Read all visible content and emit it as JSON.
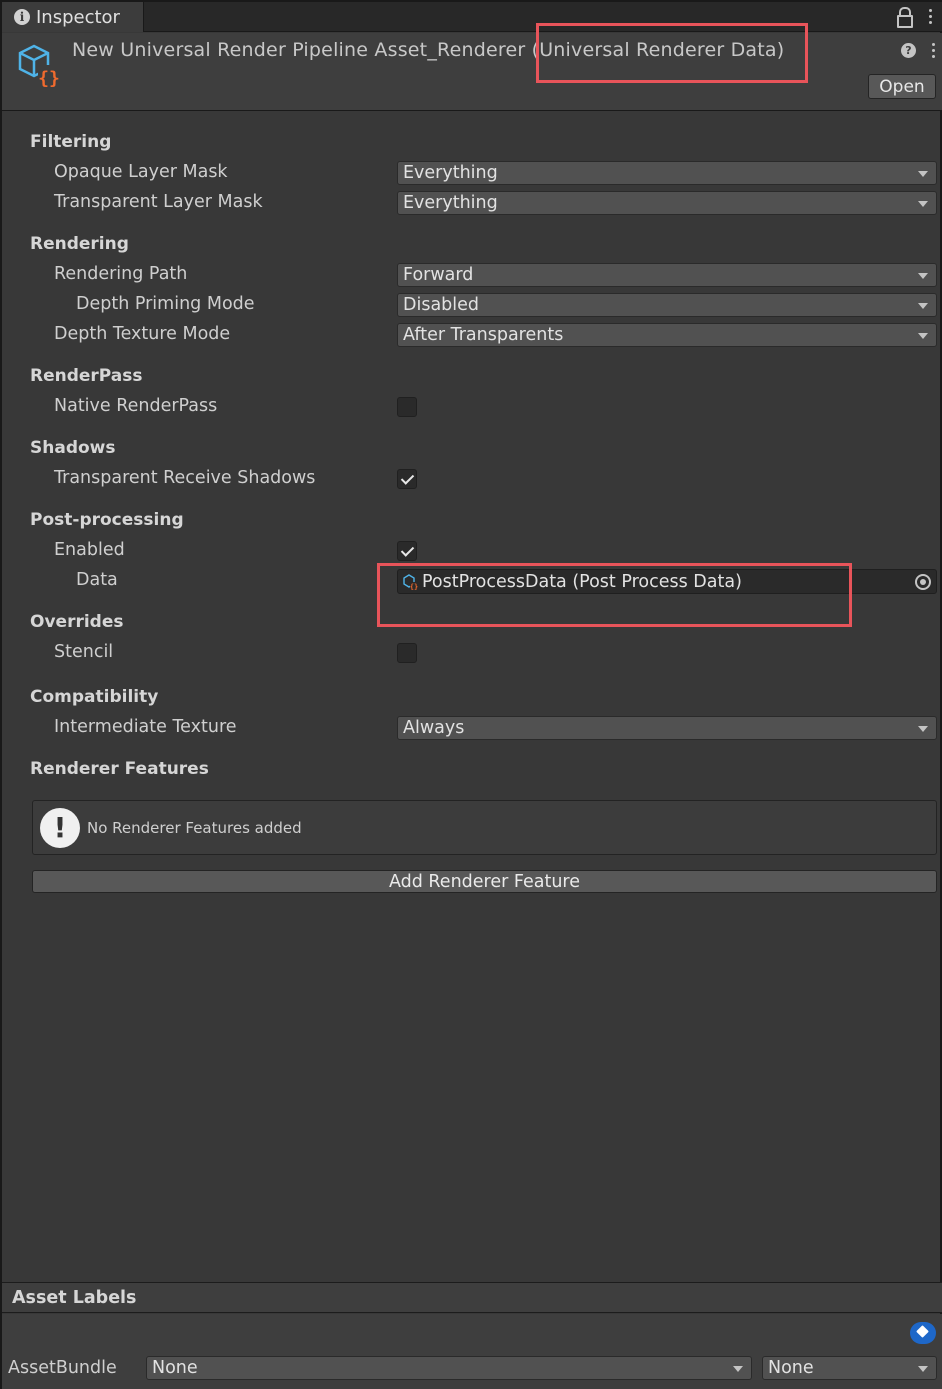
{
  "tab": {
    "label": "Inspector"
  },
  "header": {
    "title": "New Universal Render Pipeline Asset_Renderer (Universal Renderer Data)",
    "open_label": "Open"
  },
  "sections": {
    "filtering": "Filtering",
    "rendering": "Rendering",
    "renderpass": "RenderPass",
    "shadows": "Shadows",
    "postprocessing": "Post-processing",
    "overrides": "Overrides",
    "compatibility": "Compatibility",
    "renderer_features": "Renderer Features"
  },
  "props": {
    "opaque_layer_mask": {
      "label": "Opaque Layer Mask",
      "value": "Everything"
    },
    "transparent_layer_mask": {
      "label": "Transparent Layer Mask",
      "value": "Everything"
    },
    "rendering_path": {
      "label": "Rendering Path",
      "value": "Forward"
    },
    "depth_priming_mode": {
      "label": "Depth Priming Mode",
      "value": "Disabled"
    },
    "depth_texture_mode": {
      "label": "Depth Texture Mode",
      "value": "After Transparents"
    },
    "native_renderpass": {
      "label": "Native RenderPass",
      "checked": false
    },
    "transparent_receive_shadows": {
      "label": "Transparent Receive Shadows",
      "checked": true
    },
    "pp_enabled": {
      "label": "Enabled",
      "checked": true
    },
    "pp_data": {
      "label": "Data",
      "value": "PostProcessData (Post Process Data)"
    },
    "stencil": {
      "label": "Stencil",
      "checked": false
    },
    "intermediate_texture": {
      "label": "Intermediate Texture",
      "value": "Always"
    }
  },
  "renderer_features": {
    "empty_message": "No Renderer Features added",
    "add_button": "Add Renderer Feature"
  },
  "asset_labels": {
    "title": "Asset Labels",
    "assetbundle_label": "AssetBundle",
    "assetbundle_value": "None",
    "variant_value": "None"
  },
  "colors": {
    "highlight": "#e8545a",
    "accent": "#1e67c8",
    "icon_blue": "#4fb3e8",
    "icon_orange": "#f06a2e"
  }
}
